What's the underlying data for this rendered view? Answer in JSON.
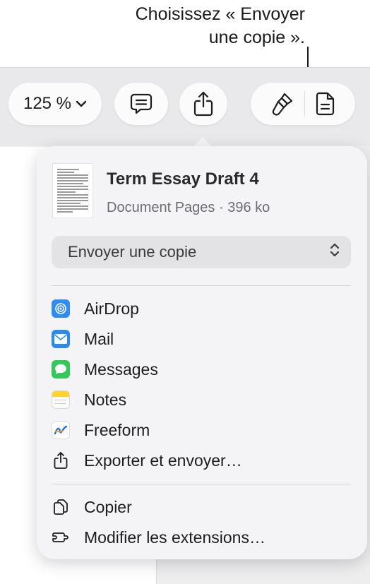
{
  "callout": {
    "line1": "Choisissez « Envoyer",
    "line2": "une copie »."
  },
  "toolbar": {
    "zoom_value": "125 %"
  },
  "share_popover": {
    "doc_title": "Term Essay Draft 4",
    "doc_subtitle": "Document Pages · 396 ko",
    "send_mode_value": "Envoyer une copie",
    "share_items": [
      {
        "label": "AirDrop",
        "icon": "airdrop-icon",
        "color": "#2f8cf3"
      },
      {
        "label": "Mail",
        "icon": "mail-icon",
        "color": "#2a8af0"
      },
      {
        "label": "Messages",
        "icon": "messages-icon",
        "color": "#34c759"
      },
      {
        "label": "Notes",
        "icon": "notes-icon",
        "color": "#ffd426"
      },
      {
        "label": "Freeform",
        "icon": "freeform-icon",
        "color": "#ffffff"
      },
      {
        "label": "Exporter et envoyer…",
        "icon": "export-icon",
        "color": "#1d1d1f"
      }
    ],
    "other_items": [
      {
        "label": "Copier",
        "icon": "copy-icon"
      },
      {
        "label": "Modifier les extensions…",
        "icon": "extensions-icon"
      }
    ]
  }
}
